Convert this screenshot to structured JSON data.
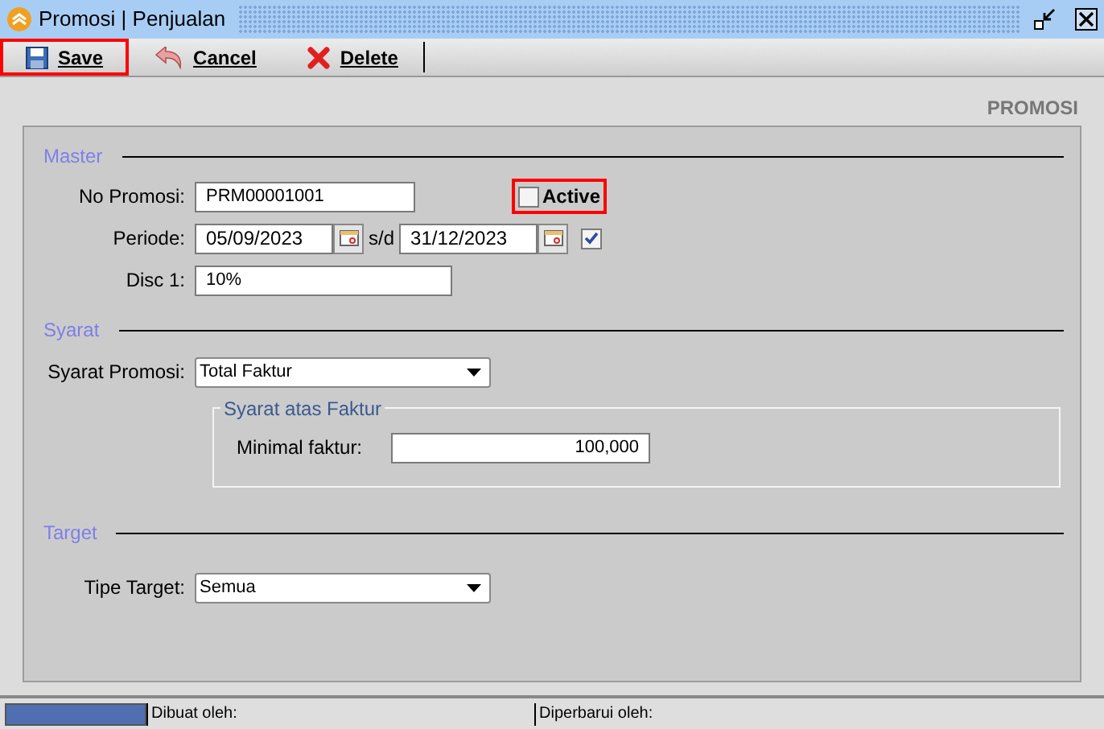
{
  "window": {
    "title": "Promosi | Penjualan"
  },
  "toolbar": [
    {
      "label": "Save",
      "kind": "save",
      "highlighted": true
    },
    {
      "label": "Cancel",
      "kind": "undo",
      "highlighted": false
    },
    {
      "label": "Delete",
      "kind": "delete",
      "highlighted": false
    }
  ],
  "form_title": "PROMOSI",
  "master": {
    "heading": "Master",
    "no_promosi": {
      "label": "No Promosi:",
      "value": "PRM00001001"
    },
    "active": {
      "label": "Active",
      "checked": false,
      "highlighted": true
    },
    "periode": {
      "label": "Periode:",
      "from": "05/09/2023",
      "separator": "s/d",
      "to": "31/12/2023",
      "checked": true
    },
    "disc": {
      "label": "Disc 1:",
      "value": "10%"
    }
  },
  "syarat": {
    "heading": "Syarat",
    "syarat_promosi": {
      "label": "Syarat Promosi:",
      "value": "Total Faktur"
    },
    "group": {
      "title": "Syarat atas Faktur",
      "label": "Minimal faktur:",
      "value": "100,000"
    }
  },
  "target": {
    "heading": "Target",
    "tipe_target": {
      "label": "Tipe Target:",
      "value": "Semua"
    }
  },
  "status_bar": {
    "level": 1,
    "created_by": "Dibuat oleh:",
    "updated_by": "Diperbarui oleh:"
  }
}
